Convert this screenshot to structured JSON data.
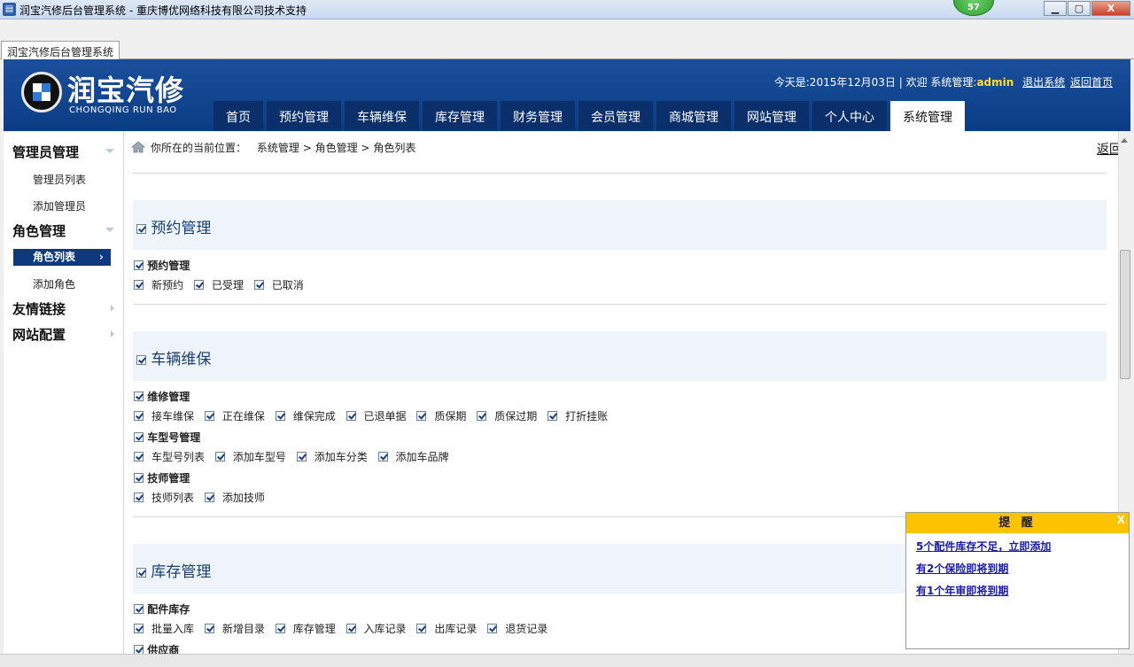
{
  "window": {
    "title": "润宝汽修后台管理系统 - 重庆博优网络科技有限公司技术支持",
    "badge": "57",
    "buttons": {
      "minimize": "▁",
      "maximize": "▢",
      "close": "X"
    }
  },
  "doc_tab": "润宝汽修后台管理系统",
  "header": {
    "logo_text": "润宝汽修",
    "logo_sub": "CHONGQING RUN BAO",
    "date_label": "今天是:2015年12月03日",
    "sep": "|",
    "welcome": "欢迎 系统管理:",
    "admin": "admin",
    "logout": "退出系统",
    "home_link": "返回首页",
    "nav": [
      "首页",
      "预约管理",
      "车辆维保",
      "库存管理",
      "财务管理",
      "会员管理",
      "商城管理",
      "网站管理",
      "个人中心",
      "系统管理"
    ],
    "active_nav": "系统管理"
  },
  "sidebar": {
    "g1": "管理员管理",
    "g1_items": [
      "管理员列表",
      "添加管理员"
    ],
    "g2": "角色管理",
    "g2_items": [
      "角色列表",
      "添加角色"
    ],
    "g3": "友情链接",
    "g4": "网站配置",
    "active_arrow": "›"
  },
  "main": {
    "crumb_prefix": "你所在的当前位置：",
    "crumb_1": "系统管理",
    "crumb_sep": ">",
    "crumb_2": "角色管理",
    "crumb_3": "角色列表",
    "back": "返回",
    "s1": {
      "title": "预约管理",
      "g1": "预约管理",
      "g1_opts": [
        "新预约",
        "已受理",
        "已取消"
      ]
    },
    "s2": {
      "title": "车辆维保",
      "g1": "维修管理",
      "g1_opts": [
        "接车维保",
        "正在维保",
        "维保完成",
        "已退单据",
        "质保期",
        "质保过期",
        "打折挂账"
      ],
      "g2": "车型号管理",
      "g2_opts": [
        "车型号列表",
        "添加车型号",
        "添加车分类",
        "添加车品牌"
      ],
      "g3": "技师管理",
      "g3_opts": [
        "技师列表",
        "添加技师"
      ]
    },
    "s3": {
      "title": "库存管理",
      "g1": "配件库存",
      "g1_opts": [
        "批量入库",
        "新增目录",
        "库存管理",
        "入库记录",
        "出库记录",
        "退货记录"
      ],
      "g2": "供应商"
    }
  },
  "popup": {
    "title": "提 醒",
    "close": "X",
    "links": [
      "5个配件库存不足，立即添加",
      "有2个保险即将到期",
      "有1个年审即将到期"
    ]
  }
}
